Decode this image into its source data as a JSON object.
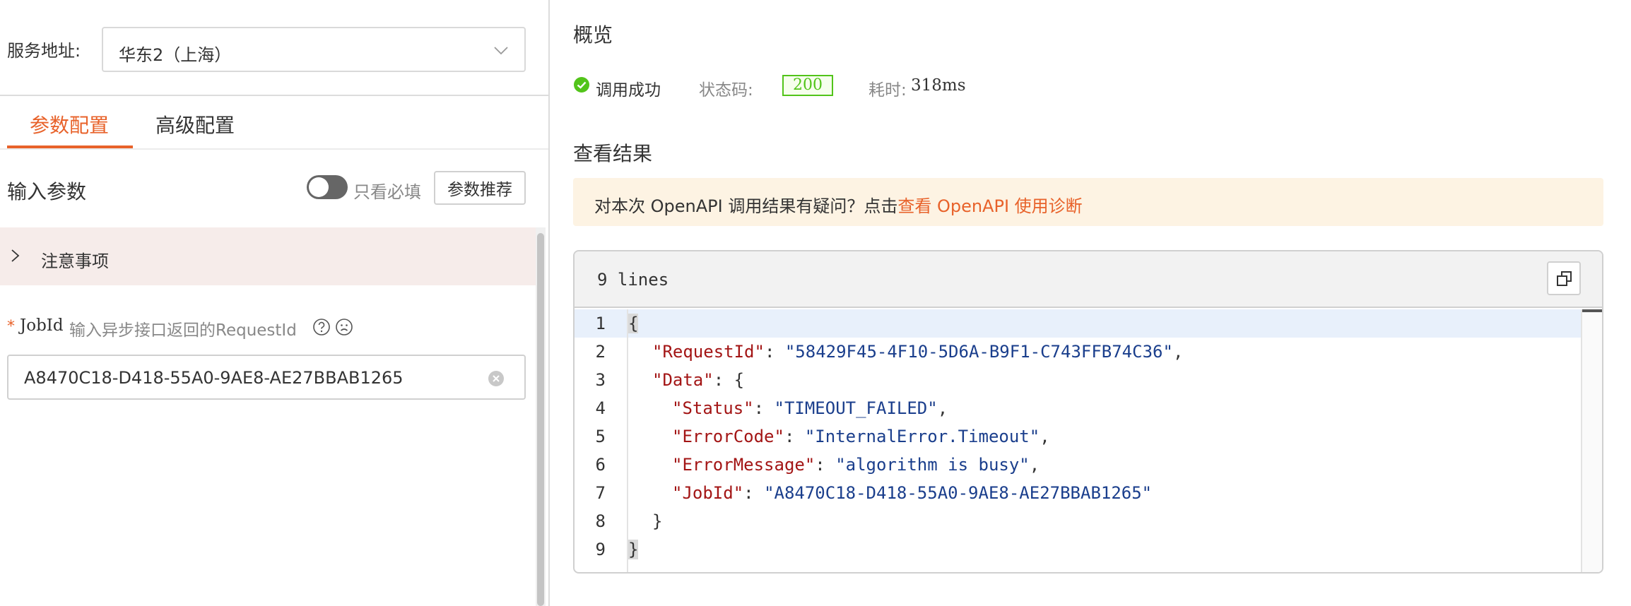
{
  "left": {
    "service_label": "服务地址:",
    "service_value": "华东2（上海）",
    "tabs": [
      {
        "label": "参数配置",
        "active": true
      },
      {
        "label": "高级配置",
        "active": false
      }
    ],
    "input_params_title": "输入参数",
    "only_required_label": "只看必填",
    "only_required_on": false,
    "recommend_button": "参数推荐",
    "notice_label": "注意事项",
    "jobid": {
      "required_mark": "*",
      "name": "JobId",
      "description": "输入异步接口返回的RequestId",
      "value": "A8470C18-D418-55A0-9AE8-AE27BBAB1265"
    }
  },
  "right": {
    "overview_title": "概览",
    "status": {
      "result_text": "调用成功",
      "code_label": "状态码:",
      "code_value": "200",
      "time_label": "耗时:",
      "time_value": "318ms"
    },
    "results_title": "查看结果",
    "banner": {
      "text": "对本次 OpenAPI 调用结果有疑问？点击",
      "link": "查看 OpenAPI 使用诊断"
    },
    "code": {
      "line_count_label": "9 lines",
      "line_numbers": [
        "1",
        "2",
        "3",
        "4",
        "5",
        "6",
        "7",
        "8",
        "9"
      ],
      "open_brace": "{",
      "close_brace": "}",
      "request_id_key": "\"RequestId\"",
      "request_id_value": "\"58429F45-4F10-5D6A-B9F1-C743FFB74C36\"",
      "data_key": "\"Data\"",
      "status_key": "\"Status\"",
      "status_value": "\"TIMEOUT_FAILED\"",
      "error_code_key": "\"ErrorCode\"",
      "error_code_value": "\"InternalError.Timeout\"",
      "error_message_key": "\"ErrorMessage\"",
      "error_message_value": "\"algorithm is busy\"",
      "jobid_key": "\"JobId\"",
      "jobid_value": "\"A8470C18-D418-55A0-9AE8-AE27BBAB1265\""
    }
  },
  "colors": {
    "accent": "#e8622a",
    "success": "#52c41a",
    "json_key": "#a31515",
    "json_string": "#1a3e8c",
    "banner_bg": "#fdf3e3",
    "notice_bg": "#f6ecea"
  }
}
